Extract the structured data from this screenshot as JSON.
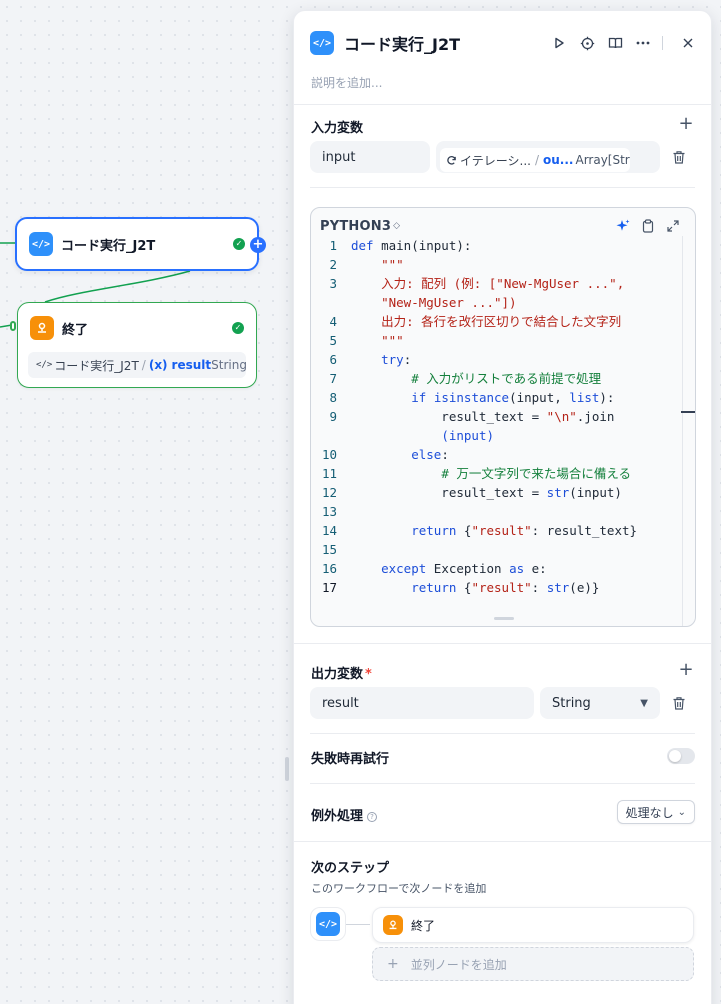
{
  "canvas": {
    "code_node": {
      "title": "コード実行_J2T",
      "icon": "code-icon"
    },
    "end_node": {
      "title": "終了",
      "icon": "end-icon",
      "var_source": "コード実行_J2T",
      "var_symbol": "(x)",
      "var_name": "result",
      "var_type": "String"
    }
  },
  "panel": {
    "title": "コード実行_J2T",
    "description_placeholder": "説明を追加...",
    "header_icons": [
      "run-icon",
      "locate-icon",
      "docs-icon",
      "more-icon",
      "close-icon"
    ],
    "input_section": {
      "title": "入力変数",
      "var_name": "input",
      "ref_source": "イテレーシ...",
      "ref_var": "ou...",
      "ref_type": "Array[String]"
    },
    "editor": {
      "language": "PYTHON3",
      "language_caret": "◇",
      "lines": [
        {
          "n": "1",
          "html": "<span class=\"kw\">def</span> main(input):"
        },
        {
          "n": "2",
          "html": "    <span class=\"str\">\"\"\"</span>"
        },
        {
          "n": "3",
          "html": "    <span class=\"str\">入力: 配列 (例: [\"New-MgUser ...\",</span>"
        },
        {
          "n": "",
          "html": "    <span class=\"str\">\"New-MgUser ...\"])</span>"
        },
        {
          "n": "4",
          "html": "    <span class=\"str\">出力: 各行を改行区切りで結合した文字列</span>"
        },
        {
          "n": "5",
          "html": "    <span class=\"str\">\"\"\"</span>"
        },
        {
          "n": "6",
          "html": "    <span class=\"kw\">try</span>:"
        },
        {
          "n": "7",
          "html": "        <span class=\"cm\"># 入力がリストである前提で処理</span>"
        },
        {
          "n": "8",
          "html": "        <span class=\"kw\">if</span> <span class=\"bi\">isinstance</span>(input, <span class=\"bi\">list</span>):"
        },
        {
          "n": "9",
          "html": "            result_text = <span class=\"str\">\"\\n\"</span>.join"
        },
        {
          "n": "",
          "html": "            <span class=\"bi\">(input)</span>"
        },
        {
          "n": "10",
          "html": "        <span class=\"kw\">else</span>:"
        },
        {
          "n": "11",
          "html": "            <span class=\"cm\"># 万一文字列で来た場合に備える</span>"
        },
        {
          "n": "12",
          "html": "            result_text = <span class=\"bi\">str</span>(input)"
        },
        {
          "n": "13",
          "html": ""
        },
        {
          "n": "14",
          "html": "        <span class=\"kw\">return</span> {<span class=\"str\">\"result\"</span>: result_text}"
        },
        {
          "n": "15",
          "html": ""
        },
        {
          "n": "16",
          "html": "    <span class=\"kw\">except</span> Exception <span class=\"kw\">as</span> e:"
        },
        {
          "n": "17",
          "html": "        <span class=\"kw\">return</span> {<span class=\"str\">\"result\"</span>: <span class=\"bi\">str</span>(e)}"
        }
      ]
    },
    "output_section": {
      "title": "出力変数",
      "required_mark": "*",
      "var_name": "result",
      "var_type": "String"
    },
    "retry": {
      "label": "失敗時再試行",
      "enabled": false
    },
    "exception": {
      "label": "例外処理",
      "value": "処理なし"
    },
    "next_step": {
      "title": "次のステップ",
      "subtitle": "このワークフローで次ノードを追加",
      "node_label": "終了",
      "add_parallel": "並列ノードを追加"
    }
  },
  "colors": {
    "accent": "#2970ff",
    "success": "#12a150",
    "code_icon_bg": "#2e90fa",
    "end_icon_bg": "#f79009"
  }
}
